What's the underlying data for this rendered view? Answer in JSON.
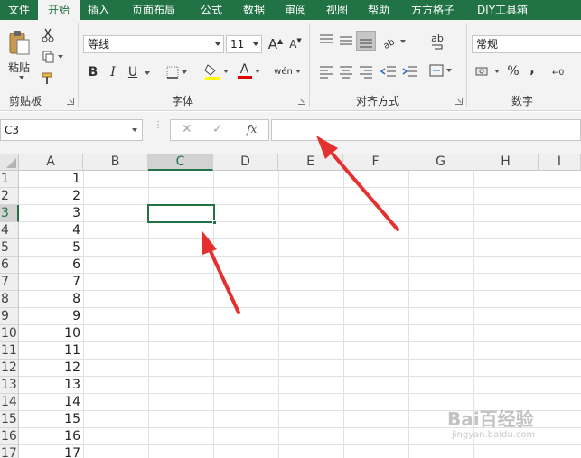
{
  "ribbon_tabs": [
    "文件",
    "开始",
    "插入",
    "页面布局",
    "公式",
    "数据",
    "审阅",
    "视图",
    "帮助",
    "方方格子",
    "DIY工具箱"
  ],
  "clipboard": {
    "paste_label": "粘贴",
    "group_label": "剪贴板"
  },
  "font": {
    "name": "等线",
    "size": "11",
    "bold": "B",
    "italic": "I",
    "underline": "U",
    "grow": "A",
    "shrink": "A",
    "font_color_letter": "A",
    "phonetic": "wén",
    "group_label": "字体"
  },
  "alignment": {
    "group_label": "对齐方式",
    "wrap_label": "ab"
  },
  "number": {
    "format": "常规",
    "percent": "%",
    "comma": ",",
    "group_label": "数字"
  },
  "formula_bar": {
    "name_box": "C3",
    "cancel": "✕",
    "confirm": "✓",
    "fx": "fx",
    "formula": ""
  },
  "columns": [
    "A",
    "B",
    "C",
    "D",
    "E",
    "F",
    "G",
    "H",
    "I"
  ],
  "selected_column": "C",
  "row_numbers": [
    "1",
    "2",
    "3",
    "4",
    "5",
    "6",
    "7",
    "8",
    "9",
    "10",
    "11",
    "12",
    "13",
    "14",
    "15",
    "16",
    "17"
  ],
  "selected_row": "3",
  "column_a_values": [
    "1",
    "2",
    "3",
    "4",
    "5",
    "6",
    "7",
    "8",
    "9",
    "10",
    "11",
    "12",
    "13",
    "14",
    "15",
    "16",
    "17"
  ],
  "active_cell": "C3",
  "watermark": {
    "main": "Bai百经验",
    "sub": "jingyan.baidu.com"
  },
  "colors": {
    "excel_green": "#217346",
    "arrow_red": "#e53030",
    "font_color_bar": "#e00000",
    "highlight_bar": "#ffff00"
  }
}
